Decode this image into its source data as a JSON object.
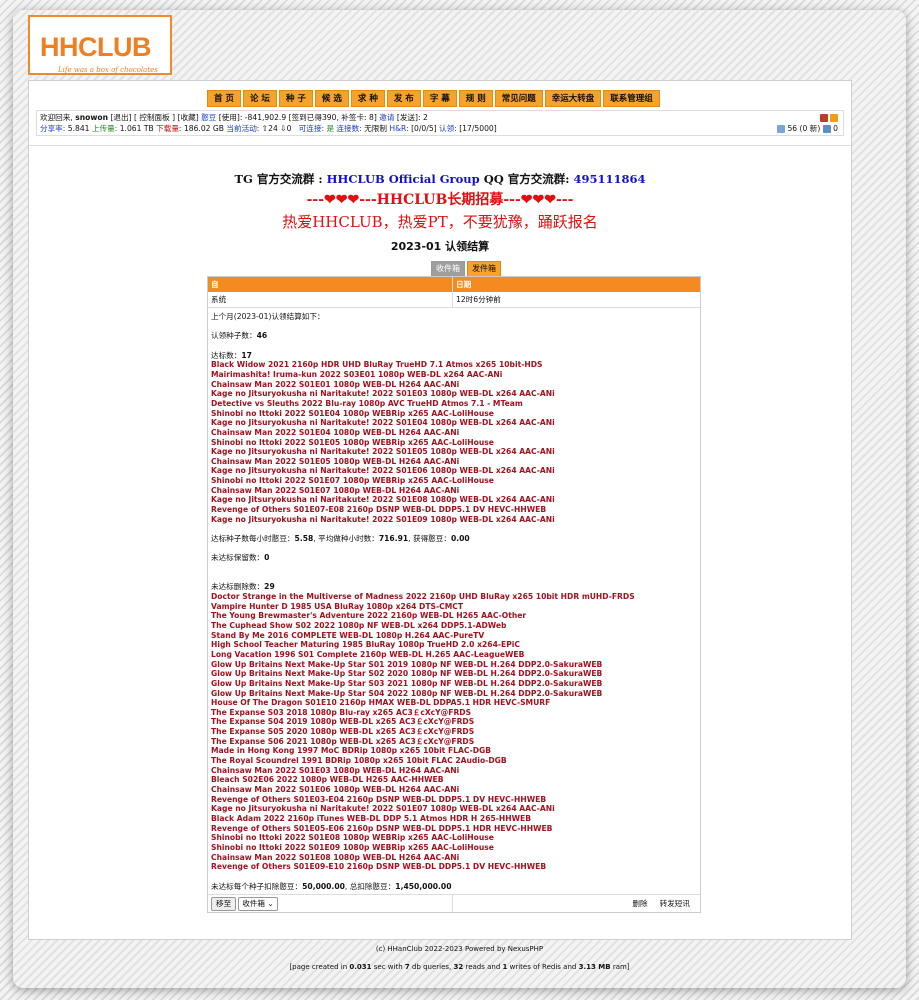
{
  "logo": {
    "text": "HHCLUB",
    "slogan": "Life was a box of chocolates"
  },
  "nav": [
    "首 页",
    "论 坛",
    "种 子",
    "候 选",
    "求 种",
    "发 布",
    "字 幕",
    "规 则",
    "常见问题",
    "幸运大转盘",
    "联系管理组"
  ],
  "user": {
    "welcome": "欢迎回来,",
    "name": "snowon",
    "logout": "[退出]",
    "panel": "[ 控制面板 ]",
    "collect": "[收藏]",
    "bonus_label": "憨豆",
    "bonus_value": "[使用]: -841,902.9",
    "signin": "[签到已得390, 补签卡: 8]",
    "invite_label": "邀请",
    "invite_value": "[发送]: 2",
    "ratio_label": "分享率:",
    "ratio": "5.841",
    "up_label": "上传量:",
    "up": "1.061 TB",
    "down_label": "下载量:",
    "down": "186.02 GB",
    "active_label": "当前活动:",
    "active": "⇧24 ⇩0",
    "connectable_label": "可连接:",
    "connectable": "是",
    "conn_count_label": "连接数:",
    "conn_count": "无限制",
    "hr_label": "H&R:",
    "hr": "[0/0/5]",
    "claim_label": "认领:",
    "claim": "[17/5000]",
    "messages": "56 (0 新)",
    "msg_count2": "0"
  },
  "announce": {
    "tg_prefix": "TG 官方交流群 :",
    "tg_link": "HHCLUB Official Group",
    "qq_prefix": "QQ 官方交流群:",
    "qq_link": "495111864",
    "recruit": "---❤❤❤---HHCLUB长期招募---❤❤❤---",
    "passion": "热爱HHCLUB，热爱PT，不要犹豫，踊跃报名"
  },
  "page_title": "2023-01 认领结算",
  "box_tabs": {
    "inbox": "收件箱",
    "outbox": "发件箱"
  },
  "table": {
    "col_from": "自",
    "col_date": "日期",
    "from": "系统",
    "date": "12时6分钟前"
  },
  "message": {
    "intro": "上个月(2023-01)认领结算如下：",
    "claimed_label": "认领种子数：",
    "claimed": "46",
    "ok_label": "达标数：",
    "ok": "17",
    "ok_torrents": [
      "Black Widow 2021 2160p HDR UHD BluRay TrueHD 7.1 Atmos x265 10bit-HDS",
      "Mairimashita! Iruma-kun 2022 S03E01 1080p WEB-DL x264 AAC-ANi",
      "Chainsaw Man 2022 S01E01 1080p WEB-DL H264 AAC-ANi",
      "Kage no Jitsuryokusha ni Naritakute! 2022 S01E03 1080p WEB-DL x264 AAC-ANi",
      "Detective vs Sleuths 2022 Blu-ray 1080p AVC TrueHD Atmos 7.1 - MTeam",
      "Shinobi no Ittoki 2022 S01E04 1080p WEBRip x265 AAC-LoliHouse",
      "Kage no Jitsuryokusha ni Naritakute! 2022 S01E04 1080p WEB-DL x264 AAC-ANi",
      "Chainsaw Man 2022 S01E04 1080p WEB-DL H264 AAC-ANi",
      "Shinobi no Ittoki 2022 S01E05 1080p WEBRip x265 AAC-LoliHouse",
      "Kage no Jitsuryokusha ni Naritakute! 2022 S01E05 1080p WEB-DL x264 AAC-ANi",
      "Chainsaw Man 2022 S01E05 1080p WEB-DL H264 AAC-ANi",
      "Kage no Jitsuryokusha ni Naritakute! 2022 S01E06 1080p WEB-DL x264 AAC-ANi",
      "Shinobi no Ittoki 2022 S01E07 1080p WEBRip x265 AAC-LoliHouse",
      "Chainsaw Man 2022 S01E07 1080p WEB-DL H264 AAC-ANi",
      "Kage no Jitsuryokusha ni Naritakute! 2022 S01E08 1080p WEB-DL x264 AAC-ANi",
      "Revenge of Others S01E07-E08 2160p DSNP WEB-DL DDP5.1 DV HEVC-HHWEB",
      "Kage no Jitsuryokusha ni Naritakute! 2022 S01E09 1080p WEB-DL x264 AAC-ANi"
    ],
    "rate_label": "达标种子数每小时憨豆：",
    "rate": "5.58",
    "avg_label": ", 平均做种小时数：",
    "avg": "716.91",
    "gain_label": ", 获得憨豆：",
    "gain": "0.00",
    "keep_label": "未达标保留数：",
    "keep": "0",
    "del_label": "未达标删除数：",
    "del": "29",
    "del_torrents": [
      "Doctor Strange in the Multiverse of Madness 2022 2160p UHD BluRay x265 10bit HDR mUHD-FRDS",
      "Vampire Hunter D 1985 USA BluRay 1080p x264 DTS-CMCT",
      "The Young Brewmaster's Adventure 2022 2160p WEB-DL H265 AAC-Other",
      "The Cuphead Show S02 2022 1080p NF WEB-DL x264 DDP5.1-ADWeb",
      "Stand By Me 2016 COMPLETE WEB-DL 1080p H.264 AAC-PureTV",
      "High School Teacher Maturing 1985 BluRay 1080p TrueHD 2.0 x264-EPiC",
      "Long Vacation 1996 S01 Complete 2160p WEB-DL H.265 AAC-LeagueWEB",
      "Glow Up Britains Next Make-Up Star S01 2019 1080p NF WEB-DL H.264 DDP2.0-SakuraWEB",
      "Glow Up Britains Next Make-Up Star S02 2020 1080p NF WEB-DL H.264 DDP2.0-SakuraWEB",
      "Glow Up Britains Next Make-Up Star S03 2021 1080p NF WEB-DL H.264 DDP2.0-SakuraWEB",
      "Glow Up Britains Next Make-Up Star S04 2022 1080p NF WEB-DL H.264 DDP2.0-SakuraWEB",
      "House Of The Dragon S01E10 2160p HMAX WEB-DL DDPA5.1 HDR HEVC-SMURF",
      "The Expanse S03 2018 1080p Blu-ray x265 AC3￡cXcY@FRDS",
      "The Expanse S04 2019 1080p WEB-DL x265 AC3￡cXcY@FRDS",
      "The Expanse S05 2020 1080p WEB-DL x265 AC3￡cXcY@FRDS",
      "The Expanse S06 2021 1080p WEB-DL x265 AC3￡cXcY@FRDS",
      "Made in Hong Kong 1997 MoC BDRip 1080p x265 10bit FLAC-DGB",
      "The Royal Scoundrel 1991 BDRip 1080p x265 10bit FLAC 2Audio-DGB",
      "Chainsaw Man 2022 S01E03 1080p WEB-DL H264 AAC-ANi",
      "Bleach S02E06 2022 1080p WEB-DL H265 AAC-HHWEB",
      "Chainsaw Man 2022 S01E06 1080p WEB-DL H264 AAC-ANi",
      "Revenge of Others S01E03-E04 2160p DSNP WEB-DL DDP5.1 DV HEVC-HHWEB",
      "Kage no Jitsuryokusha ni Naritakute! 2022 S01E07 1080p WEB-DL x264 AAC-ANi",
      "Black Adam 2022 2160p iTunes WEB-DL DDP 5.1 Atmos HDR H 265-HHWEB",
      "Revenge of Others S01E05-E06 2160p DSNP WEB-DL DDP5.1 HDR HEVC-HHWEB",
      "Shinobi no Ittoki 2022 S01E08 1080p WEBRip x265 AAC-LoliHouse",
      "Shinobi no Ittoki 2022 S01E09 1080p WEBRip x265 AAC-LoliHouse",
      "Chainsaw Man 2022 S01E08 1080p WEB-DL H264 AAC-ANi",
      "Revenge of Others S01E09-E10 2160p DSNP WEB-DL DDP5.1 DV HEVC-HHWEB"
    ],
    "deduct_label": "未达标每个种子扣除憨豆：",
    "deduct": "50,000.00",
    "total_label": ", 总扣除憨豆：",
    "total": "1,450,000.00"
  },
  "actions": {
    "move": "移至",
    "folder": "收件箱",
    "delete": "删除",
    "forward": "转发短讯"
  },
  "footer": {
    "copyright": "(c) HHanClub 2022-2023 Powered by NexusPHP",
    "perf_prefix": "[page created in ",
    "perf_sec": "0.031",
    "perf_mid1": " sec with ",
    "perf_db": "7",
    "perf_mid2": " db queries, ",
    "perf_reads": "32",
    "perf_mid3": " reads and ",
    "perf_writes": "1",
    "perf_mid4": " writes of Redis and ",
    "perf_mem": "3.13 MB",
    "perf_suffix": " ram]"
  }
}
